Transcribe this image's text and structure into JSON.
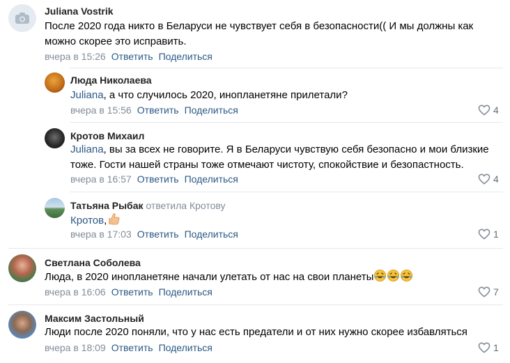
{
  "comments": [
    {
      "author": "Juliana Vostrik",
      "text": "После 2020 года никто в Беларуси не чувствует себя в безопасности(( И мы должны как можно скорее это исправить.",
      "time": "вчера в 15:26",
      "reply_label": "Ответить",
      "share_label": "Поделиться"
    },
    {
      "author": "Люда Николаева",
      "mention": "Juliana",
      "text": ", а что случилось 2020, инопланетяне прилетали?",
      "time": "вчера в 15:56",
      "reply_label": "Ответить",
      "share_label": "Поделиться",
      "likes": "4"
    },
    {
      "author": "Кротов Михаил",
      "mention": "Juliana",
      "text": ", вы за всех не говорите. Я в Беларуси чувствую себя безопасно и мои близкие тоже. Гости нашей страны тоже отмечают чистоту, спокойствие и безопастность.",
      "time": "вчера в 16:57",
      "reply_label": "Ответить",
      "share_label": "Поделиться",
      "likes": "4"
    },
    {
      "author": "Татьяна Рыбак",
      "replied_to": "ответила Кротову",
      "mention": "Кротов",
      "text": ",",
      "time": "вчера в 17:03",
      "reply_label": "Ответить",
      "share_label": "Поделиться",
      "likes": "1"
    },
    {
      "author": "Светлана Соболева",
      "text": "Люда, в 2020 инопланетяне начали улетать от нас на свои планеты",
      "time": "вчера в 16:06",
      "reply_label": "Ответить",
      "share_label": "Поделиться",
      "likes": "7"
    },
    {
      "author": "Максим Застольный",
      "text": "Люди после 2020 поняли, что у нас есть предатели и от них нужно скорее избавляться",
      "time": "вчера в 18:09",
      "reply_label": "Ответить",
      "share_label": "Поделиться",
      "likes": "1"
    }
  ],
  "colors": {
    "link": "#2a5885",
    "meta": "#818c99",
    "divider": "#e7e8ec"
  },
  "icons": {
    "like": "heart-outline-icon",
    "camera": "camera-icon"
  }
}
